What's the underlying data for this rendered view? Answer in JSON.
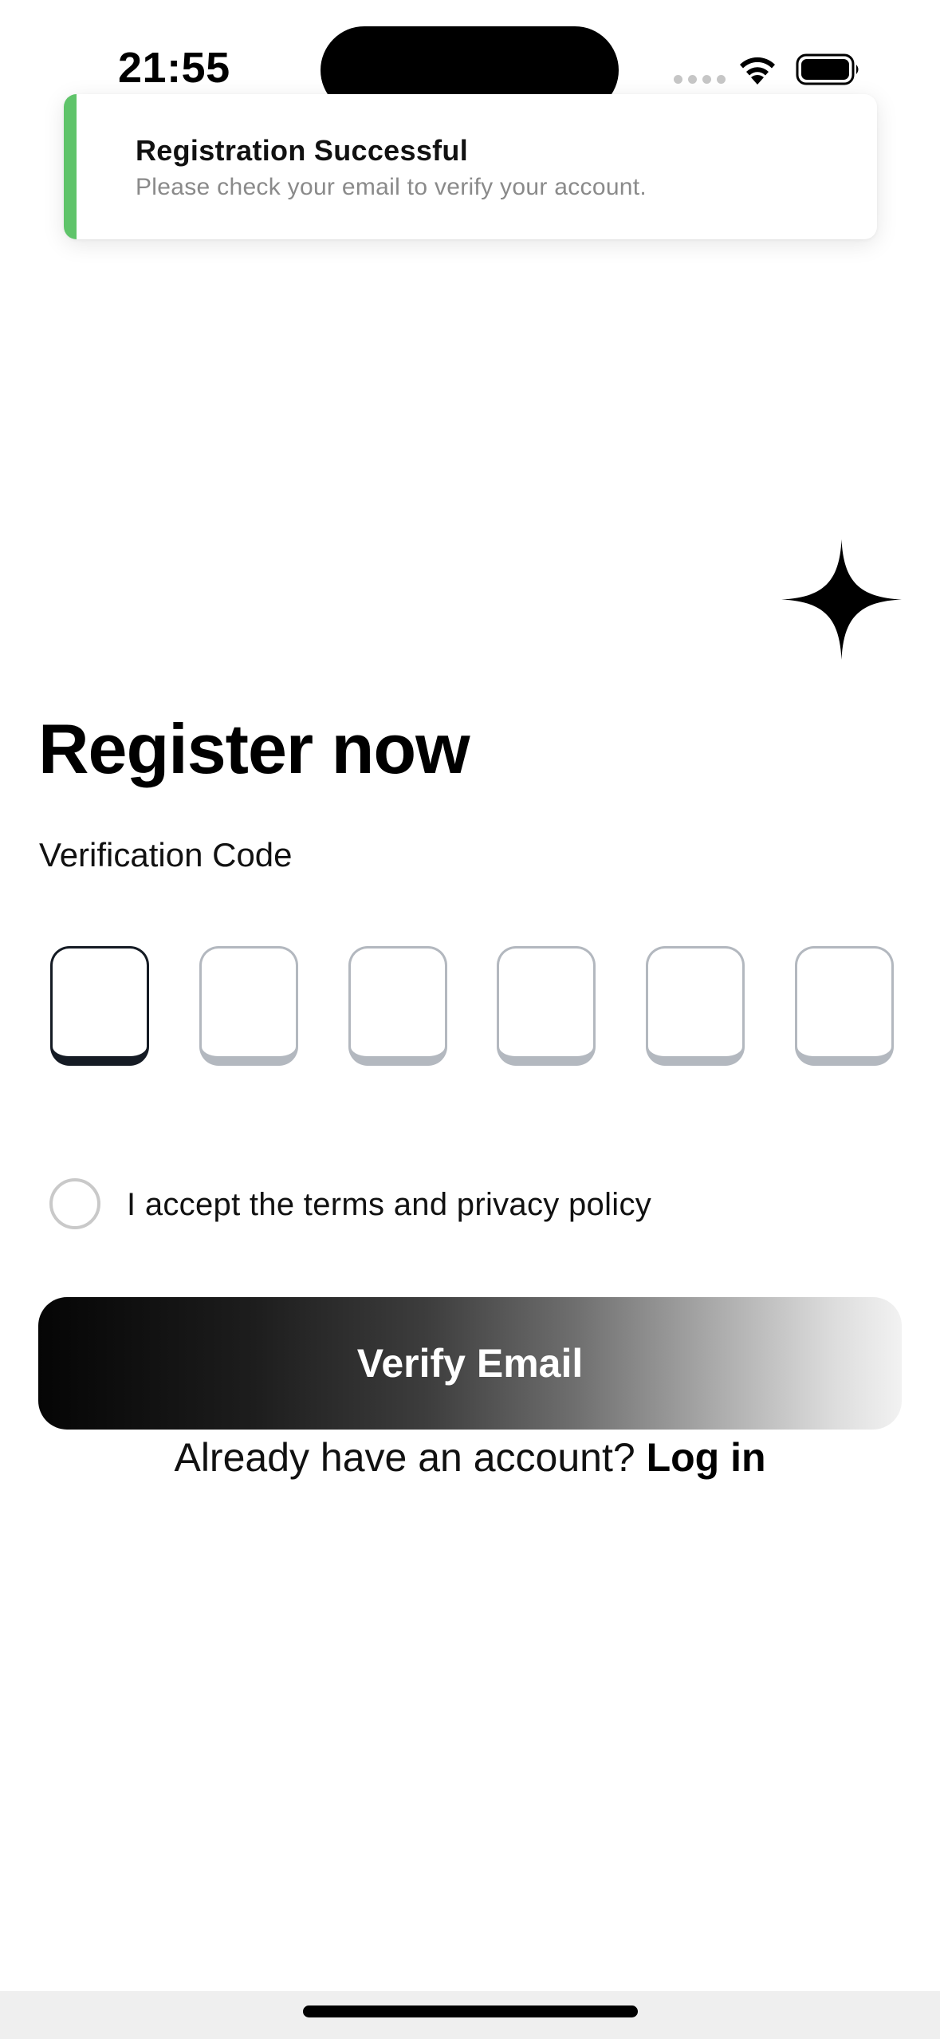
{
  "status_bar": {
    "time": "21:55",
    "wifi_icon": "wifi-icon",
    "battery_icon": "battery-icon"
  },
  "toast": {
    "title": "Registration Successful",
    "message": "Please check your email to verify your account.",
    "accent_color": "#5fc46a"
  },
  "decoration": {
    "icon": "sparkle-icon"
  },
  "page": {
    "title": "Register now"
  },
  "verification": {
    "label": "Verification Code",
    "digits": [
      "",
      "",
      "",
      "",
      "",
      ""
    ],
    "active_index": 0
  },
  "terms": {
    "label": "I accept the terms and privacy policy",
    "checked": false
  },
  "actions": {
    "verify_label": "Verify Email",
    "login_prompt": "Already have an account?",
    "login_link": "Log in"
  }
}
